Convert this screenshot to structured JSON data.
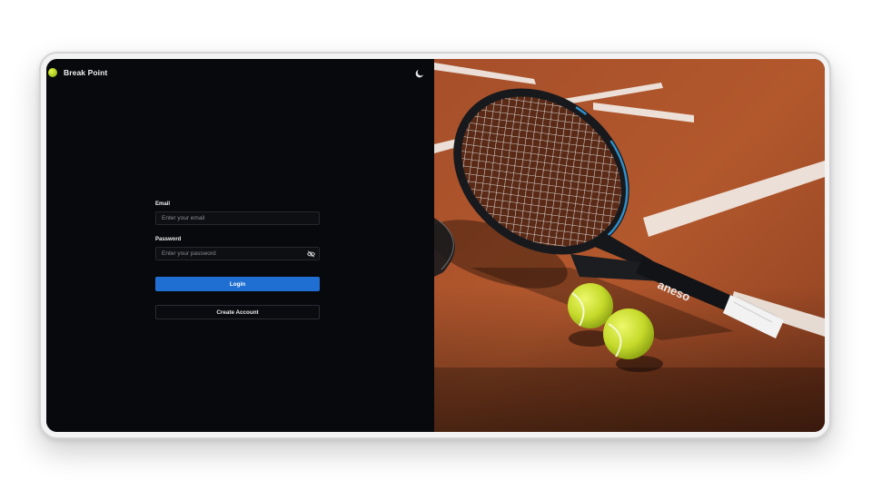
{
  "app": {
    "name": "Break Point"
  },
  "header": {
    "logo_icon": "tennis-ball-icon",
    "theme_icon": "moon-icon"
  },
  "login_form": {
    "email_label": "Email",
    "email_placeholder": "Enter your email",
    "email_value": "",
    "password_label": "Password",
    "password_placeholder": "Enter your password",
    "password_value": "",
    "password_toggle_icon": "eye-off-icon",
    "login_label": "Login",
    "create_account_label": "Create Account"
  },
  "hero": {
    "image": "tennis-racket-and-balls-on-clay-court"
  },
  "colors": {
    "background": "#08090c",
    "accent": "#1f6fd2",
    "input_border": "#26272c",
    "clay": "#a9502a"
  }
}
